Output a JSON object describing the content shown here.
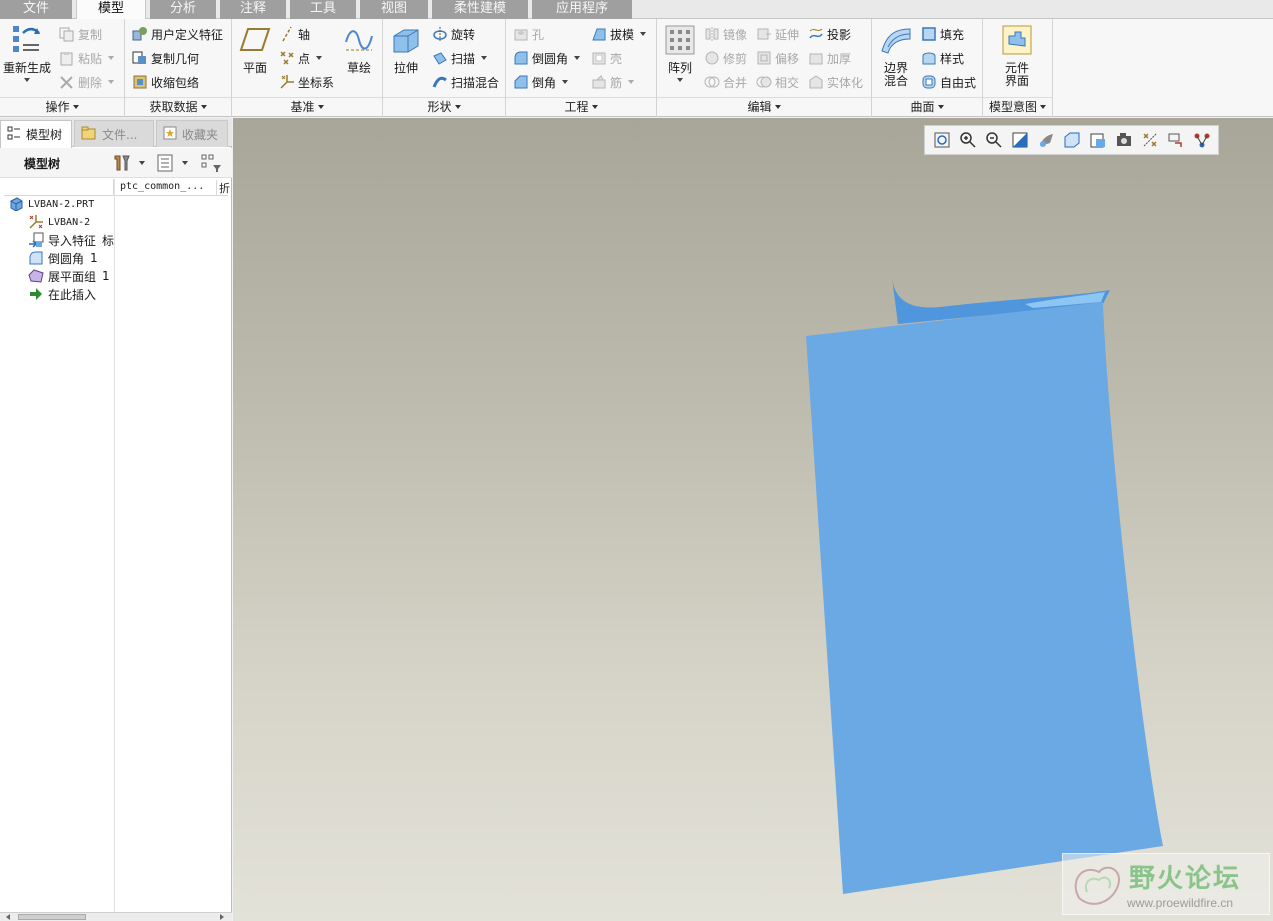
{
  "tabs": [
    "文件",
    "模型",
    "分析",
    "注释",
    "工具",
    "视图",
    "柔性建模",
    "应用程序"
  ],
  "active_tab": "模型",
  "ribbon": {
    "operations": {
      "label": "操作",
      "regenerate": "重新生成",
      "copy": "复制",
      "paste": "粘贴",
      "delete": "删除"
    },
    "get_data": {
      "label": "获取数据",
      "udf": "用户定义特征",
      "copy_geom": "复制几何",
      "shrinkwrap": "收缩包络"
    },
    "datum": {
      "label": "基准",
      "plane": "平面",
      "axis": "轴",
      "point": "点",
      "csys": "坐标系",
      "sketch": "草绘"
    },
    "shape": {
      "label": "形状",
      "extrude": "拉伸",
      "revolve": "旋转",
      "sweep": "扫描",
      "swept_blend": "扫描混合"
    },
    "engineering": {
      "label": "工程",
      "hole": "孔",
      "draft": "拔模",
      "round": "倒圆角",
      "shell": "壳",
      "chamfer": "倒角",
      "rib": "筋"
    },
    "editing": {
      "label": "编辑",
      "pattern": "阵列",
      "mirror": "镜像",
      "extend": "延伸",
      "project": "投影",
      "trim": "修剪",
      "offset": "偏移",
      "thicken": "加厚",
      "merge": "合并",
      "intersect": "相交",
      "solidify": "实体化"
    },
    "surfaces": {
      "label": "曲面",
      "boundary_blend": "边界混合",
      "fill": "填充",
      "style": "样式",
      "freestyle": "自由式"
    },
    "model_intent": {
      "label": "模型意图",
      "component_interface": "元件界面"
    }
  },
  "panel": {
    "tabs": [
      "模型树",
      "文件...",
      "收藏夹"
    ],
    "toolbar_title": "模型树",
    "column_header": "ptc_common_...",
    "column_header_extra": "折",
    "tree": [
      {
        "label": "LVBAN-2.PRT",
        "icon": "part-icon",
        "mono": true,
        "extra": ""
      },
      {
        "label": "LVBAN-2",
        "icon": "csys-icon",
        "mono": true,
        "extra": ""
      },
      {
        "label": "导入特征",
        "icon": "import-feature-icon",
        "mono": false,
        "extra": "标"
      },
      {
        "label": "倒圆角",
        "icon": "round-icon",
        "mono": false,
        "extra": "1"
      },
      {
        "label": "展平面组",
        "icon": "flatten-quilt-icon",
        "mono": false,
        "extra": "1"
      },
      {
        "label": "在此插入",
        "icon": "insert-here-icon",
        "mono": false,
        "extra": ""
      }
    ]
  },
  "watermark": {
    "title": "野火论坛",
    "url": "www.proewildfire.cn"
  },
  "colors": {
    "surface": "#6aa9e4",
    "surface_curl": "#4f96dd",
    "ribbon_bg": "#f7f7f7",
    "tab_inactive": "#9f9f9f"
  }
}
